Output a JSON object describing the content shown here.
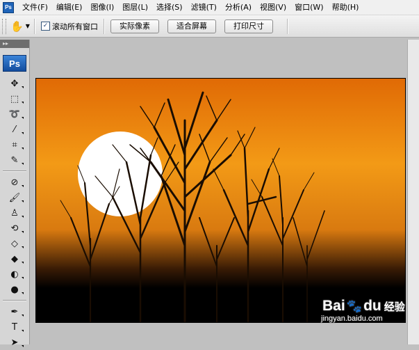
{
  "app": {
    "logo_text": "Ps"
  },
  "menubar": {
    "items": [
      "文件(F)",
      "编辑(E)",
      "图像(I)",
      "图层(L)",
      "选择(S)",
      "滤镜(T)",
      "分析(A)",
      "视图(V)",
      "窗口(W)",
      "帮助(H)"
    ]
  },
  "options": {
    "hand_icon": "hand-icon",
    "scroll_all_label": "滚动所有窗口",
    "scroll_all_checked": true,
    "buttons": {
      "actual_pixels": "实际像素",
      "fit_screen": "适合屏幕",
      "print_size": "打印尺寸"
    }
  },
  "toolbox": {
    "logo": "Ps",
    "tools": [
      "move-icon",
      "marquee-icon",
      "lasso-icon",
      "magic-wand-icon",
      "crop-icon",
      "eyedropper-icon",
      "healing-brush-icon",
      "brush-icon",
      "clone-stamp-icon",
      "history-brush-icon",
      "eraser-icon",
      "paint-bucket-icon",
      "dodge-icon",
      "blur-icon",
      "pen-icon",
      "type-icon",
      "path-select-icon"
    ]
  },
  "canvas": {
    "description_colors": {
      "sky_top": "#e86f08",
      "sky_mid": "#f39a16",
      "ground": "#000000",
      "sun": "#ffffff"
    }
  },
  "watermark": {
    "brand": "Bai",
    "brand2": "du",
    "cn": "经验",
    "url": "jingyan.baidu.com"
  }
}
